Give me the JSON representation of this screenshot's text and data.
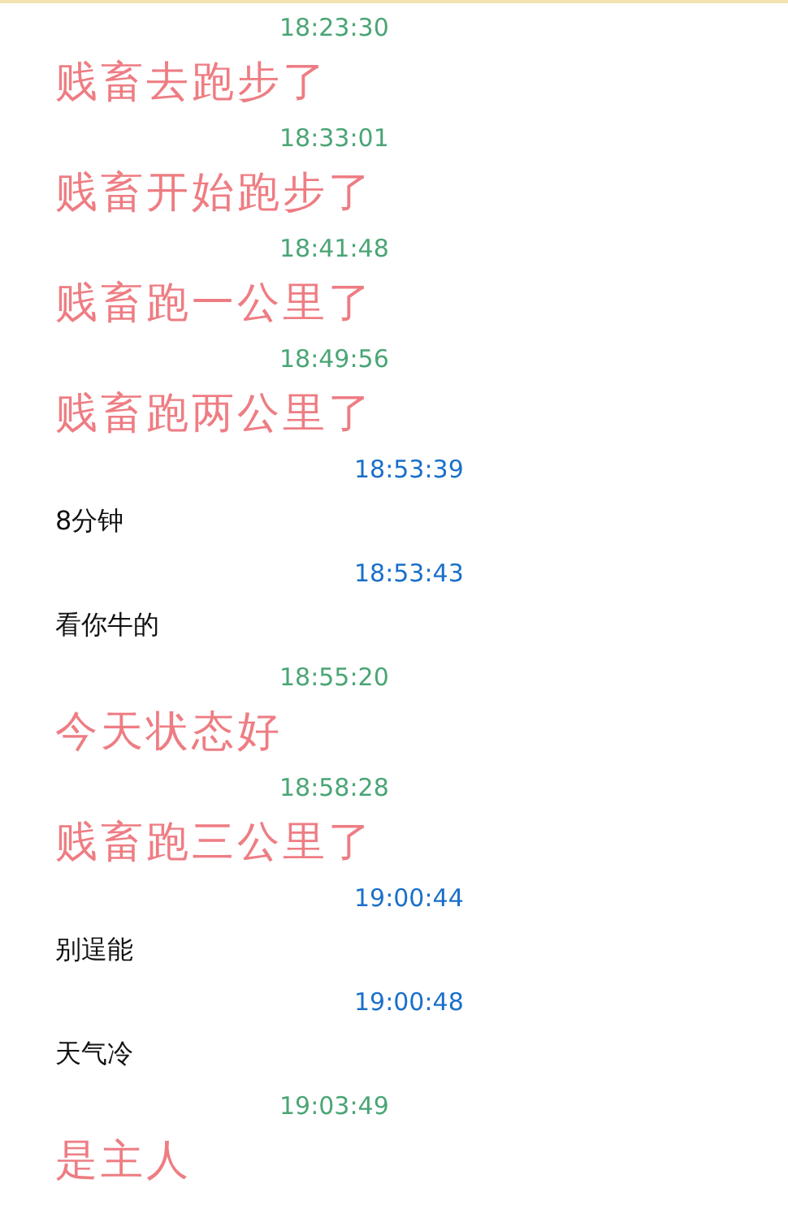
{
  "messages": [
    {
      "kind": "self",
      "time": "18:23:30",
      "text": "贱畜去跑步了"
    },
    {
      "kind": "self",
      "time": "18:33:01",
      "text": "贱畜开始跑步了"
    },
    {
      "kind": "self",
      "time": "18:41:48",
      "text": "贱畜跑一公里了"
    },
    {
      "kind": "self",
      "time": "18:49:56",
      "text": "贱畜跑两公里了"
    },
    {
      "kind": "other",
      "time": "18:53:39",
      "text": "8分钟"
    },
    {
      "kind": "other",
      "time": "18:53:43",
      "text": "看你牛的"
    },
    {
      "kind": "self",
      "time": "18:55:20",
      "text": "今天状态好"
    },
    {
      "kind": "self",
      "time": "18:58:28",
      "text": "贱畜跑三公里了"
    },
    {
      "kind": "other",
      "time": "19:00:44",
      "text": "别逞能"
    },
    {
      "kind": "other",
      "time": "19:00:48",
      "text": "天气冷"
    },
    {
      "kind": "self",
      "time": "19:03:49",
      "text": "是主人"
    }
  ]
}
